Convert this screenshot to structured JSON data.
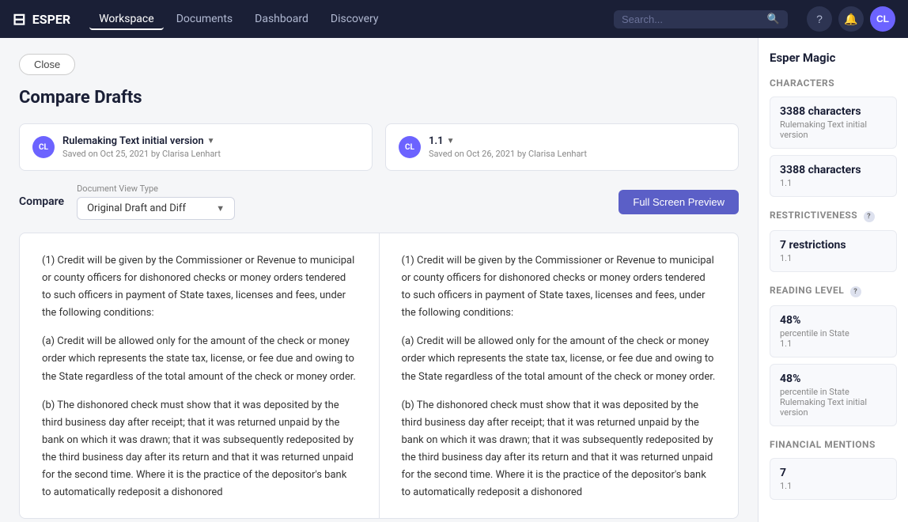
{
  "nav": {
    "logo_text": "ESPER",
    "links": [
      {
        "label": "Workspace",
        "active": true
      },
      {
        "label": "Documents",
        "active": false
      },
      {
        "label": "Dashboard",
        "active": false
      },
      {
        "label": "Discovery",
        "active": false
      }
    ],
    "search_placeholder": "Search...",
    "avatar_initials": "CL"
  },
  "page": {
    "close_label": "Close",
    "title": "Compare Drafts"
  },
  "versions": [
    {
      "name": "Rulemaking Text initial version",
      "meta": "Saved on Oct 25, 2021 by Clarisa Lenhart",
      "avatar": "CL"
    },
    {
      "name": "1.1",
      "meta": "Saved on Oct 26, 2021 by Clarisa Lenhart",
      "avatar": "CL"
    }
  ],
  "compare": {
    "label": "Compare",
    "doc_view_label": "Document View Type",
    "doc_view_value": "Original Draft and Diff",
    "preview_btn": "Full Screen Preview"
  },
  "left_doc": {
    "paragraphs": [
      "(1) Credit will be given by the Commissioner or Revenue to municipal or county officers for dishonored checks or money orders tendered to such officers in payment of State taxes, licenses and fees, under the following conditions:",
      "(a) Credit will be allowed only for the amount of the check or money order which represents the state tax, license, or fee due and owing to the State regardless of the total amount of the check or money order.",
      "(b) The dishonored check must show that it was deposited by the third business day after receipt; that it was returned unpaid by the bank on which it was drawn; that it was subsequently redeposited by the third business day after its return and that it was returned unpaid for the second time. Where it is the practice of the depositor's bank to automatically redeposit a dishonored"
    ]
  },
  "right_doc": {
    "paragraphs": [
      "(1) Credit will be given by the Commissioner or Revenue to municipal or county officers for dishonored checks or money orders tendered to such officers in payment of State taxes, licenses and fees, under the following conditions:",
      "(a) Credit will be allowed only for the amount of the check or money order which represents the state tax, license, or fee due and owing to the State regardless of the total amount of the check or money order.",
      "(b) The dishonored check must show that it was deposited by the third business day after receipt; that it was returned unpaid by the bank on which it was drawn; that it was subsequently redeposited by the third business day after its return and that it was returned unpaid for the second time. Where it is the practice of the depositor's bank to automatically redeposit a dishonored"
    ]
  },
  "sidebar": {
    "title": "Esper Magic",
    "sections": [
      {
        "label": "Characters",
        "help": false,
        "stats": [
          {
            "value": "3388 characters",
            "label": "Rulemaking Text initial version"
          },
          {
            "value": "3388 characters",
            "label": "1.1"
          }
        ]
      },
      {
        "label": "Restrictiveness",
        "help": true,
        "stats": [
          {
            "value": "7 restrictions",
            "label": "1.1"
          }
        ]
      },
      {
        "label": "Reading Level",
        "help": true,
        "stats": [
          {
            "value": "48%",
            "label": "percentile in State\n1.1"
          },
          {
            "value": "48%",
            "label": "percentile in State\nRulemaking Text initial version"
          }
        ]
      },
      {
        "label": "Financial Mentions",
        "help": false,
        "stats": [
          {
            "value": "7",
            "label": "1.1"
          }
        ]
      }
    ]
  }
}
